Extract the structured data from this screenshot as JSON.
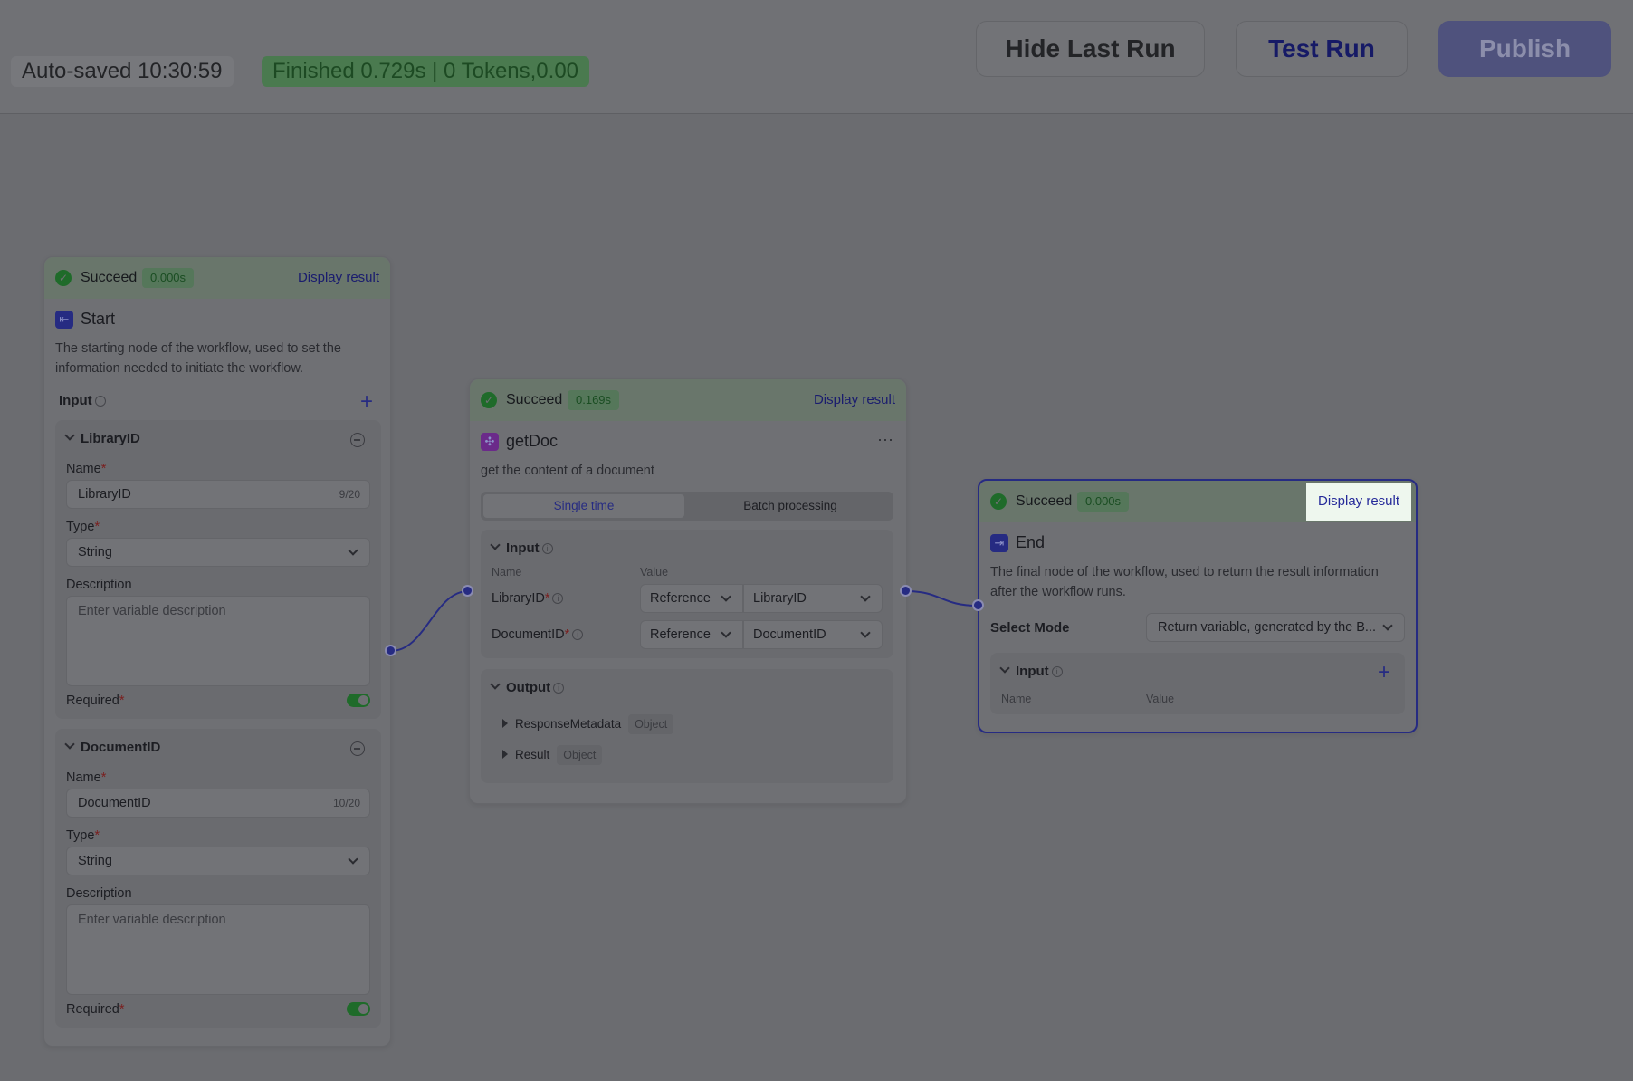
{
  "topbar": {
    "autosaved": "Auto-saved 10:30:59",
    "finished": "Finished 0.729s | 0 Tokens,0.00",
    "hide_last_run": "Hide Last Run",
    "test_run": "Test Run",
    "publish": "Publish"
  },
  "start_node": {
    "status": "Succeed",
    "time": "0.000s",
    "display_result": "Display result",
    "title": "Start",
    "description": "The starting node of the workflow, used to set the information needed to initiate the workflow.",
    "input_label": "Input",
    "variables": [
      {
        "header": "LibraryID",
        "name_label": "Name",
        "name_value": "LibraryID",
        "name_counter": "9/20",
        "type_label": "Type",
        "type_value": "String",
        "description_label": "Description",
        "description_placeholder": "Enter variable description",
        "required_label": "Required"
      },
      {
        "header": "DocumentID",
        "name_label": "Name",
        "name_value": "DocumentID",
        "name_counter": "10/20",
        "type_label": "Type",
        "type_value": "String",
        "description_label": "Description",
        "description_placeholder": "Enter variable description",
        "required_label": "Required"
      }
    ]
  },
  "getdoc_node": {
    "status": "Succeed",
    "time": "0.169s",
    "display_result": "Display result",
    "title": "getDoc",
    "more": "···",
    "description": "get the content of a document",
    "tabs": [
      "Single time",
      "Batch processing"
    ],
    "input_label": "Input",
    "col_name": "Name",
    "col_value": "Value",
    "inputs": [
      {
        "name": "LibraryID",
        "mode": "Reference",
        "value": "LibraryID"
      },
      {
        "name": "DocumentID",
        "mode": "Reference",
        "value": "DocumentID"
      }
    ],
    "output_label": "Output",
    "outputs": [
      {
        "name": "ResponseMetadata",
        "type": "Object"
      },
      {
        "name": "Result",
        "type": "Object"
      }
    ]
  },
  "end_node": {
    "status": "Succeed",
    "time": "0.000s",
    "display_result": "Display result",
    "title": "End",
    "description": "The final node of the workflow, used to return the result information after the workflow runs.",
    "select_mode_label": "Select Mode",
    "select_mode_value": "Return variable, generated by the B...",
    "input_label": "Input",
    "col_name": "Name",
    "col_value": "Value"
  }
}
